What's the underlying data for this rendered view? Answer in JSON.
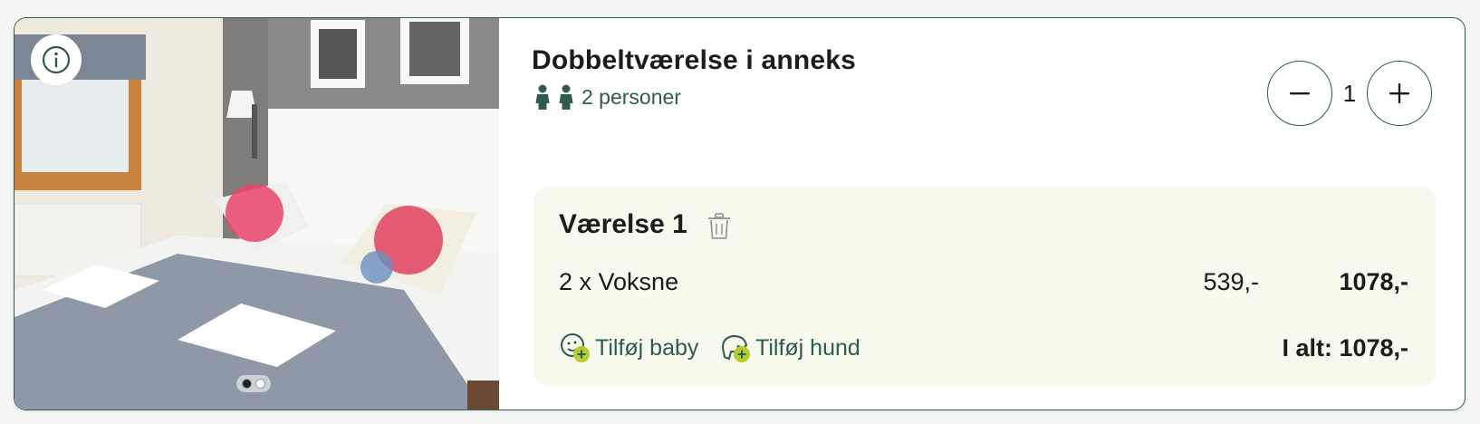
{
  "room": {
    "title": "Dobbeltværelse i anneks",
    "guests_label": "2 personer",
    "quantity": "1"
  },
  "room_box": {
    "title": "Værelse 1",
    "line_label": "2 x Voksne",
    "unit_price": "539,-",
    "line_total": "1078,-",
    "add_baby": "Tilføj baby",
    "add_dog": "Tilføj hund",
    "grand_total": "I alt: 1078,-"
  },
  "carousel": {
    "slides": 2,
    "active": 1
  },
  "colors": {
    "accent": "#2f5a52",
    "panel": "#f6f9ec",
    "addon_plus": "#b5cc2e"
  },
  "icons": [
    "info-icon",
    "person-icon",
    "minus-icon",
    "plus-icon",
    "trash-icon",
    "baby-add-icon",
    "dog-add-icon"
  ]
}
